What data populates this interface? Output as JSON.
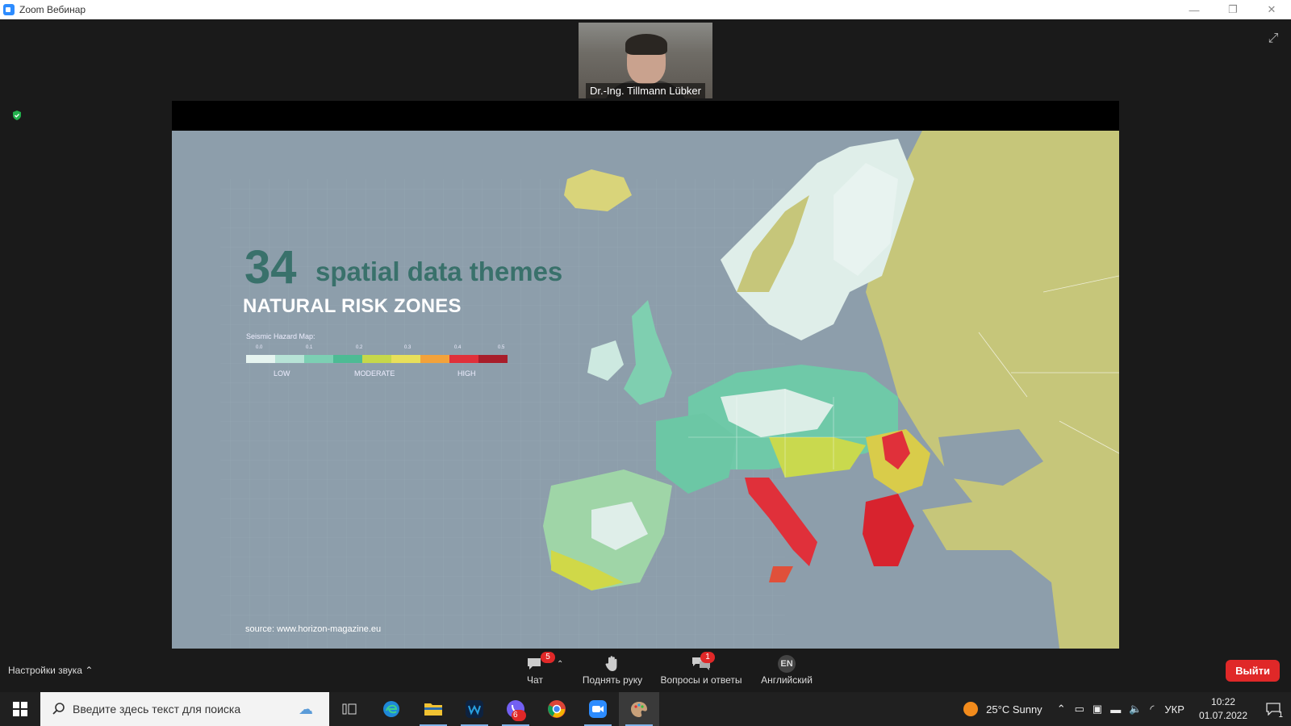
{
  "window": {
    "title": "Zoom Вебинар",
    "controls": [
      "—",
      "❐",
      "✕"
    ]
  },
  "speaker": {
    "name": "Dr.-Ing. Tillmann Lübker"
  },
  "slide": {
    "number": "34",
    "themes": "spatial data themes",
    "subtitle": "NATURAL RISK ZONES",
    "legend_title": "Seismic Hazard Map:",
    "legend_ticks": [
      "0.0",
      "0.1",
      "0.2",
      "0.3",
      "0.4",
      "0.5"
    ],
    "legend_labels": {
      "low": "LOW",
      "moderate": "MODERATE",
      "high": "HIGH"
    },
    "legend_colors": [
      "#e6f4f0",
      "#b7e3d6",
      "#7ccfb3",
      "#4dbb94",
      "#c6d84a",
      "#e8e05a",
      "#f3a23a",
      "#e0303a",
      "#a81d2a"
    ],
    "source": "source: www.horizon-magazine.eu"
  },
  "controls": {
    "audio_settings": "Настройки звука",
    "chat": {
      "label": "Чат",
      "badge": "5"
    },
    "raise_hand": {
      "label": "Поднять руку"
    },
    "qa": {
      "label": "Вопросы и ответы",
      "badge": "1"
    },
    "language": {
      "label": "Английский",
      "code": "EN"
    },
    "leave": "Выйти"
  },
  "taskbar": {
    "search_placeholder": "Введите здесь текст для поиска",
    "weather": "25°C  Sunny",
    "lang": "УКР",
    "time": "10:22",
    "date": "01.07.2022",
    "notifications": "1",
    "viber_badge": "6"
  }
}
